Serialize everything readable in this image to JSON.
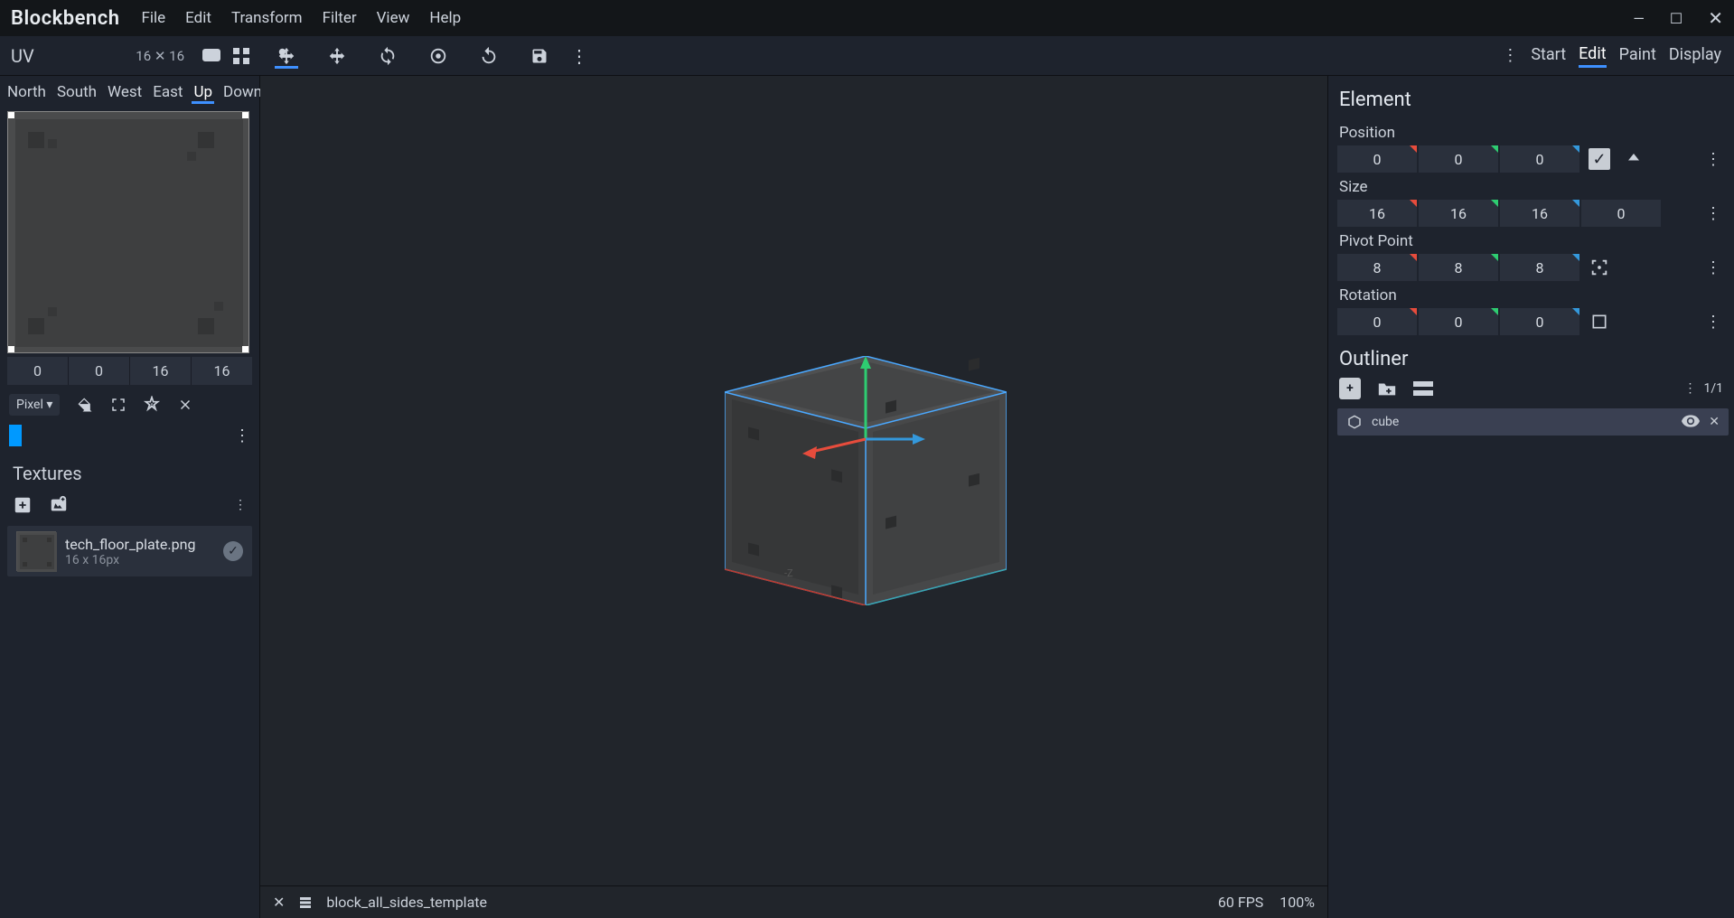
{
  "app_title": "Blockbench",
  "menu": [
    "File",
    "Edit",
    "Transform",
    "Filter",
    "View",
    "Help"
  ],
  "window_controls": {
    "min": "—",
    "max": "☐",
    "close": "✕"
  },
  "uv": {
    "label": "UV",
    "resolution": "16 ✕ 16",
    "faces": [
      "North",
      "South",
      "West",
      "East",
      "Up",
      "Down"
    ],
    "active_face": "Up",
    "coords": [
      "0",
      "0",
      "16",
      "16"
    ],
    "brush_mode": "Pixel ▾"
  },
  "textures": {
    "heading": "Textures",
    "items": [
      {
        "name": "tech_floor_plate.png",
        "size": "16 x 16px"
      }
    ]
  },
  "modes": {
    "tabs": [
      "Start",
      "Edit",
      "Paint",
      "Display"
    ],
    "active": "Edit"
  },
  "element": {
    "heading": "Element",
    "position": {
      "label": "Position",
      "values": [
        "0",
        "0",
        "0"
      ]
    },
    "size": {
      "label": "Size",
      "values": [
        "16",
        "16",
        "16",
        "0"
      ]
    },
    "pivot": {
      "label": "Pivot Point",
      "values": [
        "8",
        "8",
        "8"
      ]
    },
    "rotation": {
      "label": "Rotation",
      "values": [
        "0",
        "0",
        "0"
      ]
    }
  },
  "outliner": {
    "heading": "Outliner",
    "count": "1/1",
    "items": [
      {
        "name": "cube"
      }
    ]
  },
  "status": {
    "project": "block_all_sides_template",
    "fps": "60 FPS",
    "zoom": "100%"
  }
}
